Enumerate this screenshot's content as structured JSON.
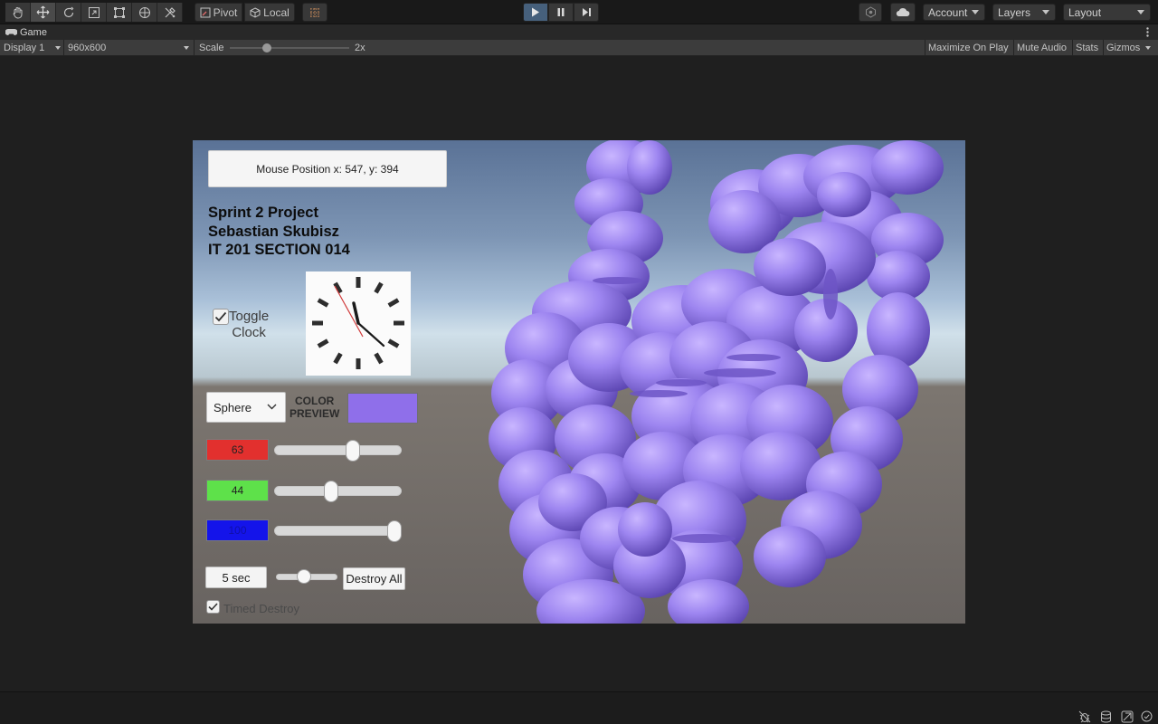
{
  "toolbar": {
    "pivot_label": "Pivot",
    "local_label": "Local",
    "account_label": "Account",
    "layers_label": "Layers",
    "layout_label": "Layout"
  },
  "tab": {
    "label": "Game"
  },
  "gamebar": {
    "display": "Display 1",
    "resolution": "960x600",
    "scale_label": "Scale",
    "scale_value": "2x",
    "maximize": "Maximize On Play",
    "mute": "Mute Audio",
    "stats": "Stats",
    "gizmos": "Gizmos"
  },
  "game": {
    "mouse_position": "Mouse Position x: 547, y: 394",
    "title_line1": "Sprint 2 Project",
    "title_line2": "Sebastian Skubisz",
    "title_line3": "IT 201 SECTION 014",
    "toggle_clock_line1": "Toggle",
    "toggle_clock_line2": "Clock",
    "shape_select": "Sphere",
    "color_label_line1": "COLOR",
    "color_label_line2": "PREVIEW",
    "preview_color": "#8f6fea",
    "red_value": "63",
    "green_value": "44",
    "blue_value": "100",
    "red_fraction": 0.63,
    "green_fraction": 0.44,
    "blue_fraction": 1.0,
    "timer_value": "5 sec",
    "timer_fraction": 0.45,
    "destroy_all": "Destroy All",
    "timed_destroy": "Timed Destroy",
    "toggle_clock_checked": true,
    "timed_destroy_checked": true
  }
}
